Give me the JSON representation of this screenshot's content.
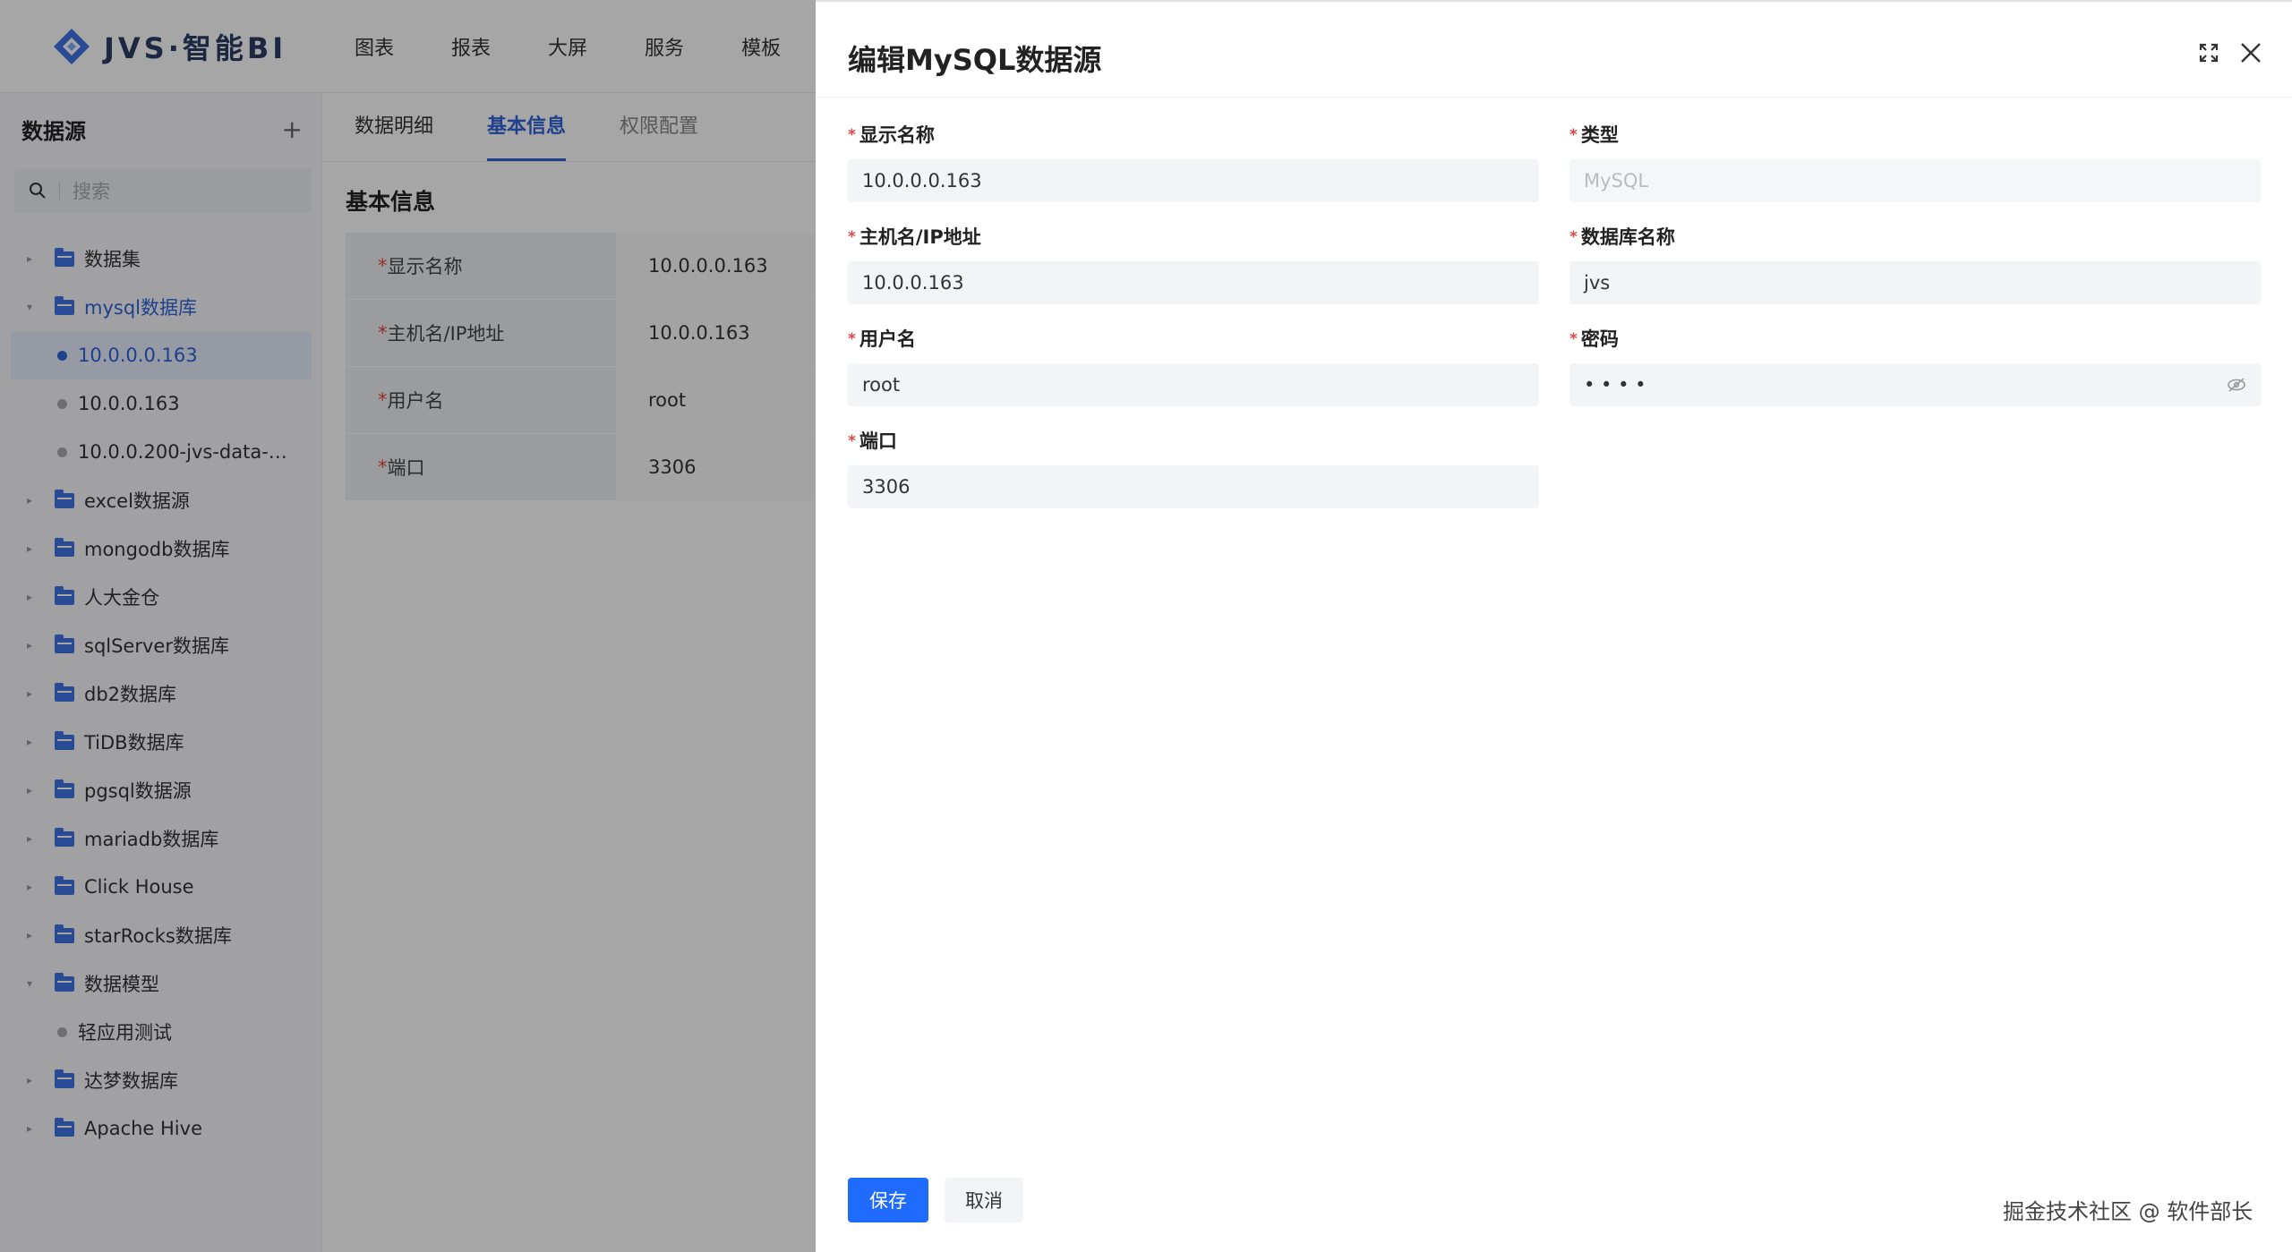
{
  "app": {
    "logo_text": "JVS·智能BI",
    "nav": [
      "图表",
      "报表",
      "大屏",
      "服务",
      "模板"
    ]
  },
  "sidebar": {
    "title": "数据源",
    "add_label": "+",
    "search_placeholder": "搜索",
    "tree": [
      {
        "label": "数据集",
        "kind": "folder",
        "expanded": false
      },
      {
        "label": "mysql数据库",
        "kind": "folder",
        "expanded": true
      },
      {
        "label": "10.0.0.0.163",
        "kind": "leaf",
        "active": true
      },
      {
        "label": "10.0.0.163",
        "kind": "leaf"
      },
      {
        "label": "10.0.0.200-jvs-data-…",
        "kind": "leaf"
      },
      {
        "label": "excel数据源",
        "kind": "folder"
      },
      {
        "label": "mongodb数据库",
        "kind": "folder"
      },
      {
        "label": "人大金仓",
        "kind": "folder"
      },
      {
        "label": "sqlServer数据库",
        "kind": "folder"
      },
      {
        "label": "db2数据库",
        "kind": "folder"
      },
      {
        "label": "TiDB数据库",
        "kind": "folder"
      },
      {
        "label": "pgsql数据源",
        "kind": "folder"
      },
      {
        "label": "mariadb数据库",
        "kind": "folder"
      },
      {
        "label": "Click House",
        "kind": "folder"
      },
      {
        "label": "starRocks数据库",
        "kind": "folder"
      },
      {
        "label": "数据模型",
        "kind": "folder",
        "expanded": true
      },
      {
        "label": "轻应用测试",
        "kind": "leaf"
      },
      {
        "label": "达梦数据库",
        "kind": "folder"
      },
      {
        "label": "Apache Hive",
        "kind": "folder"
      }
    ]
  },
  "content": {
    "tabs": [
      "数据明细",
      "基本信息",
      "权限配置"
    ],
    "active_tab": "基本信息",
    "section_title": "基本信息",
    "info": [
      {
        "key": "显示名称",
        "value": "10.0.0.0.163"
      },
      {
        "key": "主机名/IP地址",
        "value": "10.0.0.163"
      },
      {
        "key": "用户名",
        "value": "root"
      },
      {
        "key": "端口",
        "value": "3306"
      }
    ]
  },
  "drawer": {
    "title": "编辑MySQL数据源",
    "fields": {
      "display_name": {
        "label": "显示名称",
        "value": "10.0.0.0.163"
      },
      "type": {
        "label": "类型",
        "value": "MySQL"
      },
      "host": {
        "label": "主机名/IP地址",
        "value": "10.0.0.163"
      },
      "db_name": {
        "label": "数据库名称",
        "value": "jvs"
      },
      "username": {
        "label": "用户名",
        "value": "root"
      },
      "password": {
        "label": "密码",
        "value": "• • • •"
      },
      "port": {
        "label": "端口",
        "value": "3306"
      }
    },
    "required_mark": "*",
    "save_label": "保存",
    "cancel_label": "取消"
  },
  "credit": "掘金技术社区 @ 软件部长",
  "colors": {
    "accent": "#1f6bff",
    "folder": "#3f74e6",
    "required": "#e54545"
  }
}
